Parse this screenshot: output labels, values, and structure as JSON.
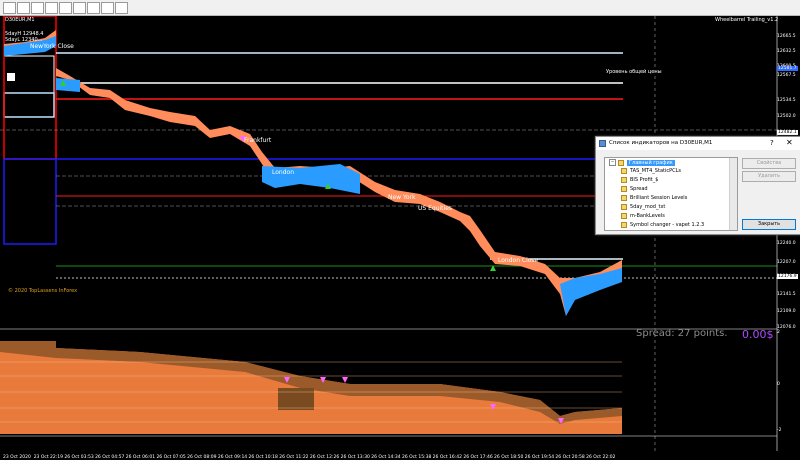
{
  "chart": {
    "symbol_title": "D30EUR,M1",
    "indicator_name": "Wheelbarrel Trailing_v1.2",
    "info_lines": [
      "5dayH 12948.4",
      "5dayL 12340..."
    ],
    "newyork_close": "NewYork Close",
    "level_label": "Уровень общей цены",
    "sessions": {
      "frankfurt": "Frankfurt",
      "london": "London",
      "newyork": "New York",
      "us_equities": "US Equities",
      "london_close": "London Close"
    },
    "copyright": "© 2020 TopLassens InForex",
    "spread": "Spread: 27 points.",
    "profit": "0.00$",
    "price_axis": [
      "12665.5",
      "12632.5",
      "12600.5",
      "12567.5",
      "12534.5",
      "12502.0",
      "12469.0",
      "12436.0",
      "12403.0",
      "12370.0",
      "12337.0",
      "12305.0",
      "12272.0",
      "12240.0",
      "12207.0",
      "12174.0",
      "12141.5",
      "12109.0",
      "12076.0"
    ],
    "price_tags": [
      {
        "text": "12581.7",
        "color": "#2f6cff"
      },
      {
        "text": "12482.1",
        "color": "#ffffff"
      },
      {
        "text": "12398.9",
        "color": "#ff2020"
      },
      {
        "text": "12176.9",
        "color": "#ffffff"
      }
    ],
    "sub_axis": [
      "2",
      "0",
      "-2"
    ],
    "time_axis": [
      "23 Oct 2020",
      "23 Oct 22:19",
      "26 Oct 03:53",
      "26 Oct 04:57",
      "26 Oct 06:01",
      "26 Oct 07:05",
      "26 Oct 08:09",
      "26 Oct 09:14",
      "26 Oct 10:18",
      "26 Oct 11:22",
      "26 Oct 12:26",
      "26 Oct 13:30",
      "26 Oct 14:34",
      "26 Oct 15:38",
      "26 Oct 16:42",
      "26 Oct 17:46",
      "26 Oct 18:50",
      "26 Oct 19:54",
      "26 Oct 20:58",
      "26 Oct 22:02"
    ]
  },
  "dialog": {
    "title": "Список индикаторов на D30EUR,M1",
    "help": "?",
    "close": "✕",
    "root": "Главный график",
    "items": [
      "TAS_MT4_StaticPCLs",
      "BIS Profit_$",
      "Spread",
      "Brilliant Session Levels",
      "5day_mod_txt",
      "m-BankLevels",
      "Symbol changer - vapet 1.2.3"
    ],
    "btn_props": "Свойства",
    "btn_delete": "Удалить",
    "btn_close": "Закрыть"
  }
}
